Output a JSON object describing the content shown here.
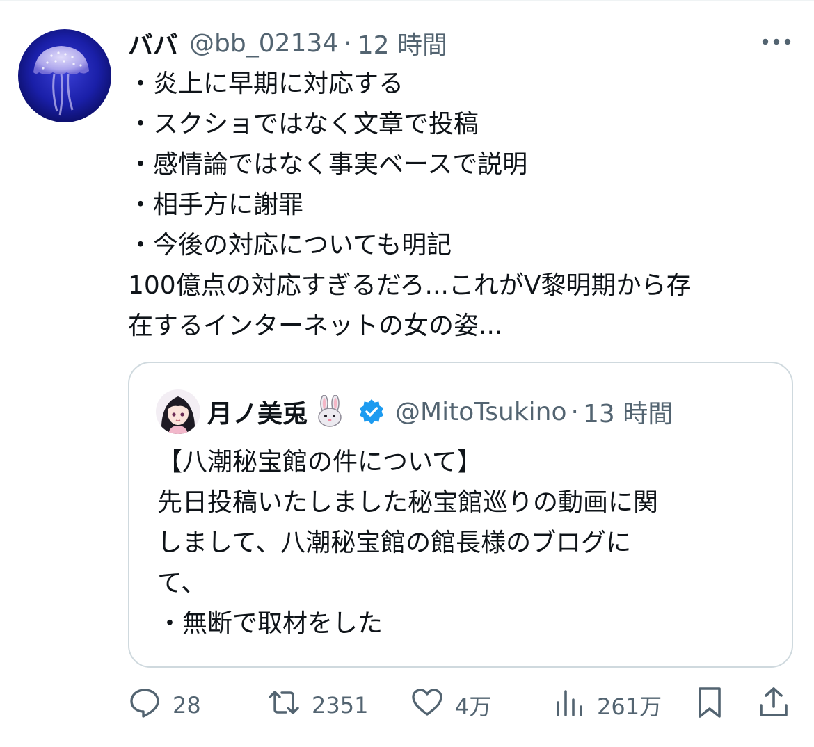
{
  "tweet": {
    "author": {
      "display_name": "ババ",
      "handle": "@bb_02134",
      "separator": "·",
      "time": "12 時間"
    },
    "lines": [
      "・炎上に早期に対応する",
      "・スクショではなく文章で投稿",
      "・感情論ではなく事実ベースで説明",
      "・相手方に謝罪",
      "・今後の対応についても明記",
      "100億点の対応すぎるだろ...これがV黎明期から存",
      "在するインターネットの女の姿..."
    ]
  },
  "quote": {
    "author": {
      "display_name": "月ノ美兎",
      "handle": "@MitoTsukino",
      "separator": "·",
      "time": "13 時間"
    },
    "lines": [
      "【八潮秘宝館の件について】",
      "先日投稿いたしました秘宝館巡りの動画に関",
      "しまして、八潮秘宝館の館長様のブログに",
      "て、",
      "・無断で取材をした"
    ]
  },
  "actions": {
    "reply_count": "28",
    "retweet_count": "2351",
    "like_count": "4万",
    "view_count": "261万"
  },
  "icons": {
    "more": "more-horizontal-icon",
    "reply": "reply-bubble-icon",
    "retweet": "retweet-icon",
    "like": "heart-icon",
    "views": "bar-chart-icon",
    "bookmark": "bookmark-icon",
    "share": "share-icon",
    "verified": "verified-badge-icon",
    "name_emoji": "rabbit-face-emoji"
  },
  "colors": {
    "text_primary": "#0f1419",
    "text_secondary": "#536471",
    "border": "#cfd9de",
    "verified": "#1d9bf0"
  }
}
